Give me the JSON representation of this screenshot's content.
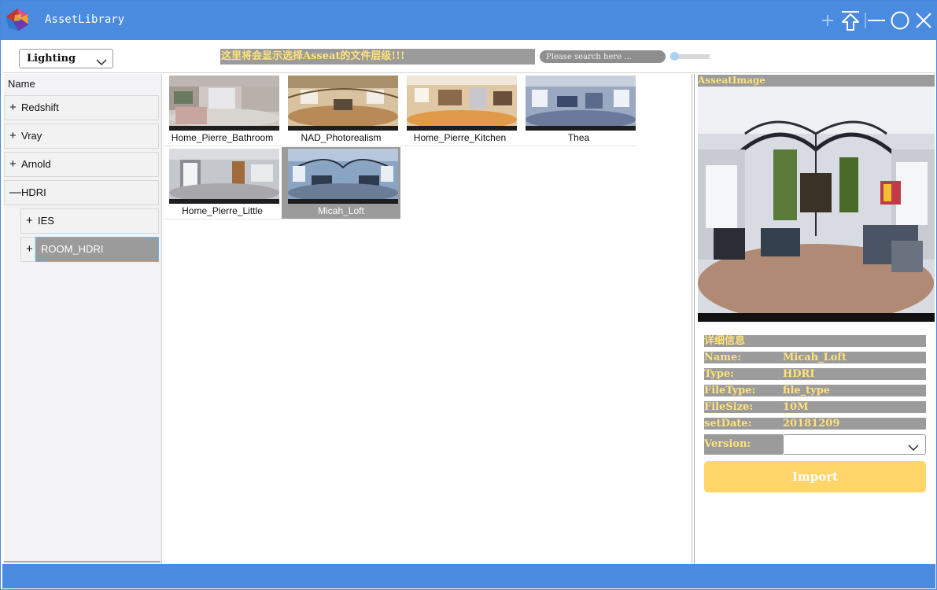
{
  "app": {
    "title": "AssetLibrary",
    "accent": "#4a8be0"
  },
  "toolbar": {
    "category": "Lighting",
    "path_text": "这里将会显示选择Asseat的文件层级!!!",
    "search_placeholder": "Please search here ...",
    "zoom_level": 0
  },
  "tree": {
    "header": "Name",
    "items": [
      {
        "label": "Redshift",
        "expander": "+"
      },
      {
        "label": "Vray",
        "expander": "+"
      },
      {
        "label": "Arnold",
        "expander": "+"
      },
      {
        "label": "HDRI",
        "expander": "—"
      },
      {
        "label": "IES",
        "expander": "+"
      },
      {
        "label": "ROOM_HDRI",
        "expander": "+"
      }
    ]
  },
  "assets": [
    {
      "name": "Home_Pierre_Bathroom"
    },
    {
      "name": "NAD_Photorealism"
    },
    {
      "name": "Home_Pierre_Kitchen"
    },
    {
      "name": "Thea"
    },
    {
      "name": "Home_Pierre_Little"
    },
    {
      "name": "Micah_Loft"
    }
  ],
  "preview": {
    "label": "AsseatImage"
  },
  "details": {
    "title": "详细信息",
    "rows": [
      {
        "key": "Name:",
        "value": "Micah_Loft"
      },
      {
        "key": "Type:",
        "value": "HDRI"
      },
      {
        "key": "FileType:",
        "value": "file_type"
      },
      {
        "key": "FileSize:",
        "value": "10M"
      },
      {
        "key": "setDate:",
        "value": "20181209"
      }
    ],
    "version_label": "Version:",
    "version_value": "",
    "import_label": "Import"
  }
}
